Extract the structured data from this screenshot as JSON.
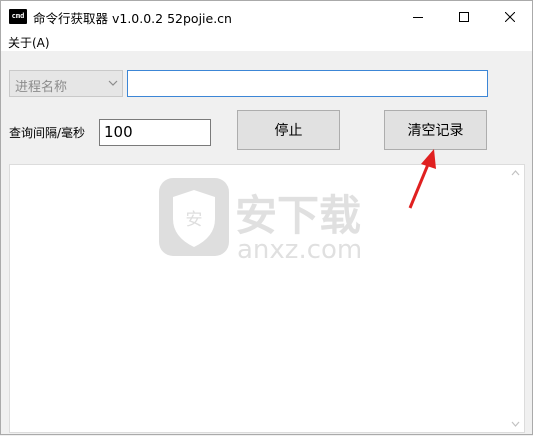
{
  "window": {
    "title": "命令行获取器 v1.0.0.2   52pojie.cn",
    "icon_text": "cmd"
  },
  "menu": {
    "items": [
      {
        "label": "关于(A)"
      }
    ]
  },
  "controls": {
    "process_combo_value": "进程名称",
    "process_input_value": "",
    "interval_label": "查询间隔/毫秒",
    "interval_value": "100",
    "stop_button": "停止",
    "clear_button": "清空记录"
  },
  "output": {
    "content": ""
  },
  "watermark": {
    "text_cn": "安下载",
    "text_en": "anxz.com",
    "badge": "安"
  },
  "colors": {
    "accent_input_border": "#3c86d6",
    "annotation_arrow": "#e02020"
  },
  "icons": {
    "minimize": "minimize-icon",
    "maximize": "maximize-icon",
    "close": "close-icon",
    "dropdown": "chevron-down-icon",
    "scroll_up": "chevron-up-icon",
    "scroll_down": "chevron-down-icon"
  }
}
